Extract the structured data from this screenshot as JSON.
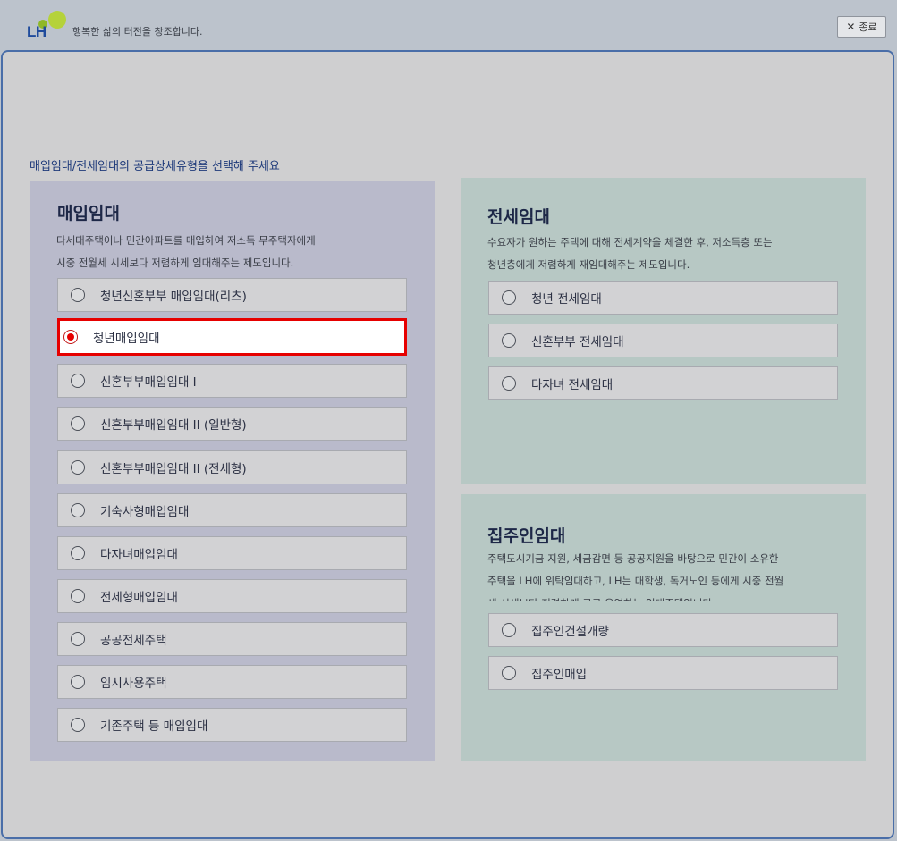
{
  "header": {
    "logo_text": "LH",
    "slogan": "행복한 삶의 터전을 창조합니다.",
    "close_label": "종료",
    "close_icon": "close-icon"
  },
  "instruction": "매입임대/전세임대의 공급상세유형을 선택해 주세요",
  "panels": {
    "purchase": {
      "title": "매입임대",
      "desc_line1": "다세대주택이나 민간아파트를 매입하여 저소득 무주택자에게",
      "desc_line2": "시중 전월세 시세보다 저렴하게 임대해주는 제도입니다.",
      "options": [
        "청년신혼부부 매입임대(리츠)",
        "청년매입임대",
        "신혼부부매입임대 I",
        "신혼부부매입임대 II (일반형)",
        "신혼부부매입임대 II (전세형)",
        "기숙사형매입임대",
        "다자녀매입임대",
        "전세형매입임대",
        "공공전세주택",
        "임시사용주택",
        "기존주택 등 매입임대"
      ],
      "selected_index": 1
    },
    "jeonse": {
      "title": "전세임대",
      "desc_line1": "수요자가 원하는 주택에 대해 전세계약을 체결한 후, 저소득층 또는",
      "desc_line2": "청년층에게 저렴하게 재임대해주는 제도입니다.",
      "options": [
        "청년 전세임대",
        "신혼부부 전세임대",
        "다자녀 전세임대"
      ]
    },
    "landlord": {
      "title": "집주인임대",
      "desc_line1": "주택도시기금 지원, 세금감면 등 공공지원을 바탕으로 민간이 소유한",
      "desc_line2": "주택을 LH에 위탁임대하고, LH는 대학생, 독거노인 등에게 시중 전월",
      "desc_line3": "세 시세보다 저렴하게 공급·운영하는 임대주택입니다",
      "options": [
        "집주인건설개량",
        "집주인매입"
      ]
    }
  },
  "colors": {
    "selected_border": "#e60000",
    "frame_border": "#4a6ea8",
    "title_navy": "#1d2747"
  }
}
